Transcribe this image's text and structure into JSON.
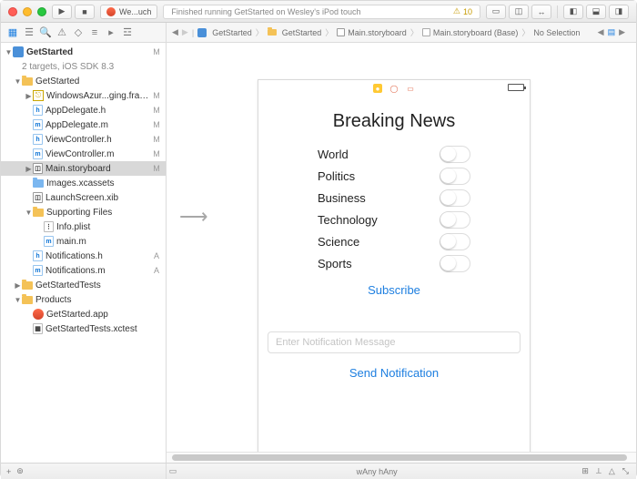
{
  "titlebar": {
    "tab": "We...uch",
    "status": "Finished running GetStarted on Wesley's iPod touch",
    "warn_count": "10"
  },
  "breadcrumb": {
    "items": [
      "GetStarted",
      "GetStarted",
      "Main.storyboard",
      "Main.storyboard (Base)",
      "No Selection"
    ]
  },
  "tree": {
    "project": "GetStarted",
    "project_sub": "2 targets, iOS SDK 8.3",
    "g1": "GetStarted",
    "f_fw": "WindowsAzur...ging.framework",
    "f_h1": "AppDelegate.h",
    "f_m1": "AppDelegate.m",
    "f_h2": "ViewController.h",
    "f_m2": "ViewController.m",
    "f_sb": "Main.storyboard",
    "f_xc": "Images.xcassets",
    "f_ls": "LaunchScreen.xib",
    "g_sup": "Supporting Files",
    "f_plist": "Info.plist",
    "f_main": "main.m",
    "f_nh": "Notifications.h",
    "f_nm": "Notifications.m",
    "g2": "GetStartedTests",
    "g3": "Products",
    "f_app": "GetStarted.app",
    "f_xct": "GetStartedTests.xctest"
  },
  "phone": {
    "title": "Breaking News",
    "categories": [
      "World",
      "Politics",
      "Business",
      "Technology",
      "Science",
      "Sports"
    ],
    "subscribe": "Subscribe",
    "placeholder": "Enter Notification Message",
    "send": "Send Notification"
  },
  "status": {
    "size": "wAny hAny"
  }
}
